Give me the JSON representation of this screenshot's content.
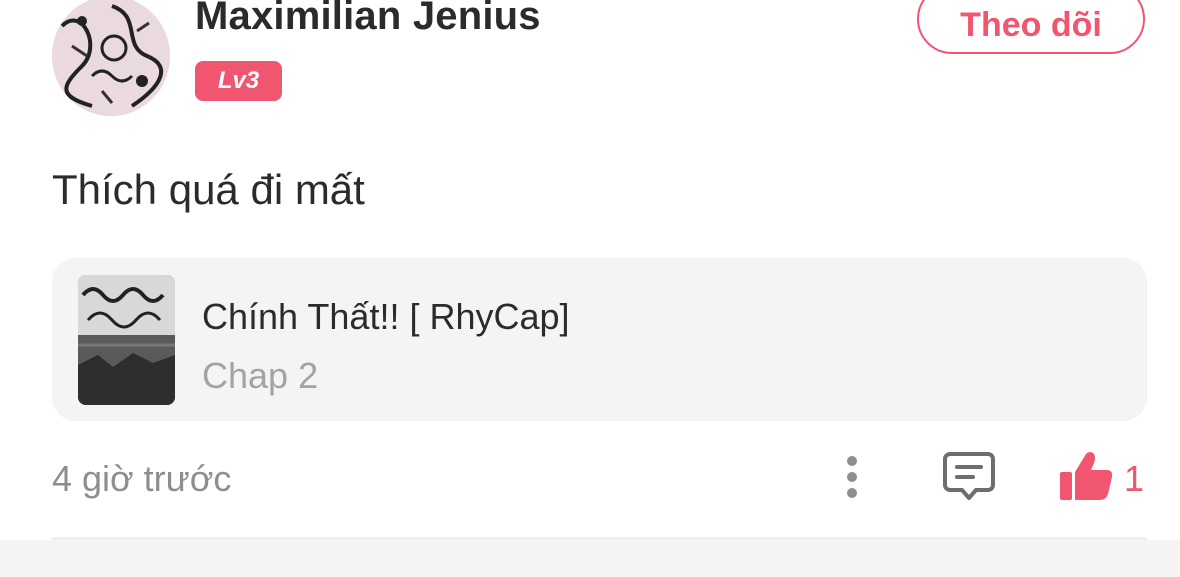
{
  "user": {
    "name": "Maximilian Jenius",
    "level": "Lv3",
    "avatar_icon": "manga-art-avatar"
  },
  "follow_button": {
    "label": "Theo dõi"
  },
  "comment": {
    "text": "Thích quá đi mất"
  },
  "manga": {
    "title": "Chính Thất!! [ RhyCap]",
    "chapter": "Chap 2",
    "cover_icon": "manga-cover-thumbnail"
  },
  "footer": {
    "time": "4 giờ trước",
    "like_count": "1",
    "icons": [
      "more-vertical-icon",
      "comment-icon",
      "thumbs-up-icon"
    ]
  },
  "colors": {
    "accent": "#f0566f",
    "text": "#2b2b2b",
    "muted": "#8e8e8e",
    "card_bg": "#f4f4f4"
  }
}
